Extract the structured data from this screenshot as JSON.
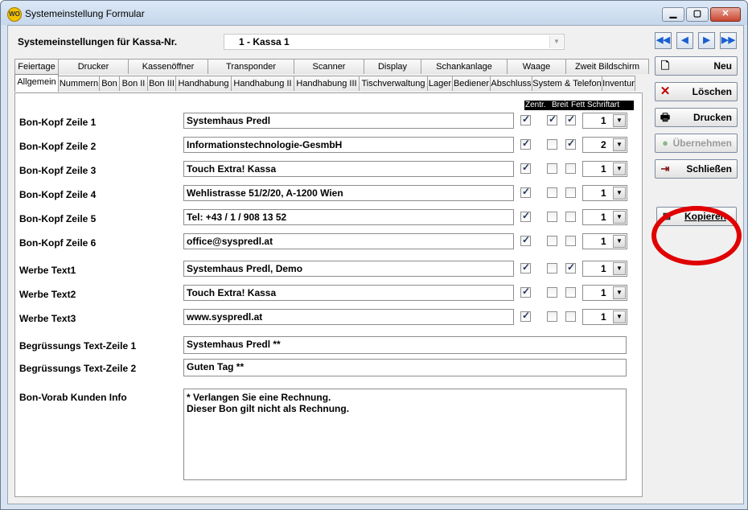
{
  "window": {
    "title": "Systemeinstellung Formular",
    "icon": "app-logo-icon",
    "controls": [
      "minimize-icon",
      "maximize-icon",
      "close-icon"
    ]
  },
  "header": {
    "label": "Systemeinstellungen für Kassa-Nr.",
    "register_value": "1 - Kassa 1"
  },
  "tabs_row1": [
    "Feiertage",
    "Drucker",
    "Kassenöffner",
    "Transponder",
    "Scanner",
    "Display",
    "Schankanlage",
    "Waage",
    "Zweit Bildschirm"
  ],
  "tabs_row2": [
    "Allgemein",
    "Nummern",
    "Bon",
    "Bon II",
    "Bon III",
    "Handhabung",
    "Handhabung II",
    "Handhabung III",
    "Tischverwaltung",
    "Lager",
    "Bediener",
    "Abschluss",
    "System & Telefon",
    "Inventur"
  ],
  "active_tab": "Allgemein",
  "columns": {
    "zentr": "Zentr.",
    "breit": "Breit",
    "fett": "Fett",
    "schriftart": "Schriftart"
  },
  "rows": [
    {
      "label": "Bon-Kopf Zeile 1",
      "value": "Systemhaus Predl",
      "zentr": true,
      "breit": true,
      "fett": true,
      "font": "1"
    },
    {
      "label": "Bon-Kopf Zeile 2",
      "value": "Informationstechnologie-GesmbH",
      "zentr": true,
      "breit": false,
      "fett": true,
      "font": "2"
    },
    {
      "label": "Bon-Kopf Zeile 3",
      "value": "Touch Extra! Kassa",
      "zentr": true,
      "breit": false,
      "fett": false,
      "font": "1"
    },
    {
      "label": "Bon-Kopf Zeile 4",
      "value": "Wehlistrasse 51/2/20, A-1200 Wien",
      "zentr": true,
      "breit": false,
      "fett": false,
      "font": "1"
    },
    {
      "label": "Bon-Kopf Zeile 5",
      "value": "Tel: +43 / 1 / 908 13 52",
      "zentr": true,
      "breit": false,
      "fett": false,
      "font": "1"
    },
    {
      "label": "Bon-Kopf Zeile 6",
      "value": "office@syspredl.at",
      "zentr": true,
      "breit": false,
      "fett": false,
      "font": "1"
    },
    {
      "label": "Werbe Text1",
      "value": "Systemhaus Predl, Demo",
      "zentr": true,
      "breit": false,
      "fett": true,
      "font": "1"
    },
    {
      "label": "Werbe Text2",
      "value": "Touch Extra! Kassa",
      "zentr": true,
      "breit": false,
      "fett": false,
      "font": "1"
    },
    {
      "label": "Werbe Text3",
      "value": "www.syspredl.at",
      "zentr": true,
      "breit": false,
      "fett": false,
      "font": "1"
    }
  ],
  "greetings": [
    {
      "label": "Begrüssungs Text-Zeile 1",
      "value": "Systemhaus Predl **"
    },
    {
      "label": "Begrüssungs Text-Zeile 2",
      "value": "Guten Tag **"
    }
  ],
  "customer_info": {
    "label": "Bon-Vorab Kunden Info",
    "value": "* Verlangen Sie eine Rechnung.\nDieser Bon gilt nicht als Rechnung."
  },
  "nav_buttons": [
    "first-record-icon",
    "previous-record-icon",
    "next-record-icon",
    "last-record-icon"
  ],
  "actions": {
    "neu": "Neu",
    "loeschen": "Löschen",
    "drucken": "Drucken",
    "uebernehmen": "Übernehmen",
    "schliessen": "Schließen",
    "kopieren": "Kopieren"
  },
  "colors": {
    "highlight_ring": "#e00000",
    "delete_icon": "#c00000"
  }
}
